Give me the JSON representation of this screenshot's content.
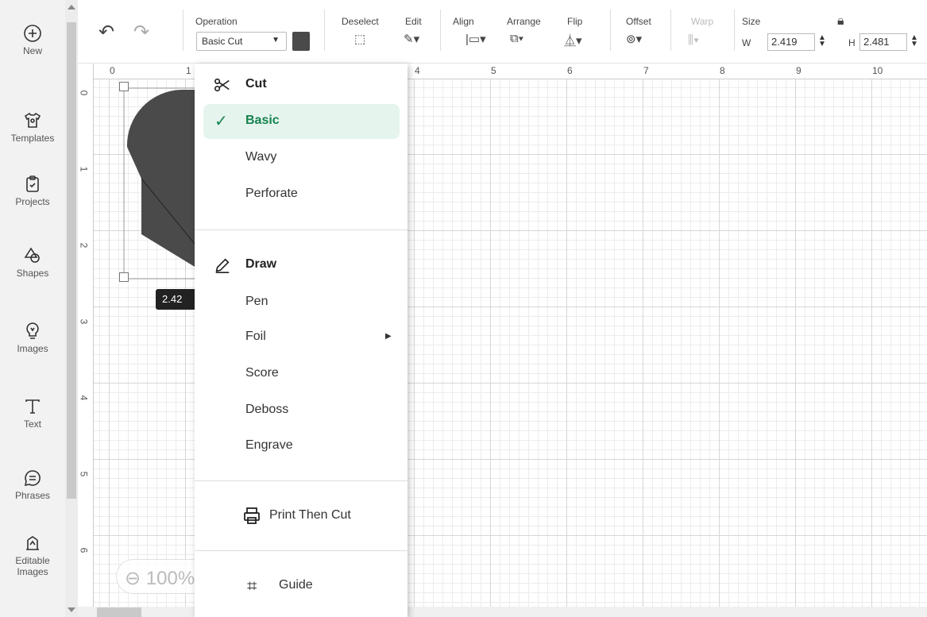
{
  "sidebar": {
    "items": [
      {
        "label": "New",
        "icon": "plus-circle-icon"
      },
      {
        "label": "Templates",
        "icon": "shirt-icon"
      },
      {
        "label": "Projects",
        "icon": "clipboard-icon"
      },
      {
        "label": "Shapes",
        "icon": "shapes-icon"
      },
      {
        "label": "Images",
        "icon": "lightbulb-icon"
      },
      {
        "label": "Text",
        "icon": "text-T-icon"
      },
      {
        "label": "Phrases",
        "icon": "speech-bubble-icon"
      },
      {
        "label": "Editable Images",
        "icon": "editable-image-icon"
      }
    ]
  },
  "toolbar": {
    "operation_label": "Operation",
    "operation_value": "Basic Cut",
    "operation_color": "#4a4a4a",
    "deselect_label": "Deselect",
    "edit_label": "Edit",
    "align_label": "Align",
    "arrange_label": "Arrange",
    "flip_label": "Flip",
    "offset_label": "Offset",
    "warp_label": "Warp",
    "size_label": "Size",
    "w_label": "W",
    "w_value": "2.419",
    "h_label": "H",
    "h_value": "2.481"
  },
  "ruler": {
    "top": [
      "0",
      "1",
      "4",
      "5",
      "6",
      "7",
      "8",
      "9",
      "10"
    ],
    "left": [
      "0",
      "1",
      "2",
      "3",
      "4",
      "5",
      "6"
    ]
  },
  "canvas": {
    "shape_color": "#4a4a4a",
    "dimension_tag": "2.42",
    "zoom": "100%"
  },
  "menu": {
    "cut_header": "Cut",
    "cut_items": [
      "Basic",
      "Wavy",
      "Perforate"
    ],
    "selected": "Basic",
    "draw_header": "Draw",
    "draw_items": [
      "Pen",
      "Foil",
      "Score",
      "Deboss",
      "Engrave"
    ],
    "print_then_cut": "Print Then Cut",
    "guide": "Guide",
    "accent_color": "#15824e"
  }
}
